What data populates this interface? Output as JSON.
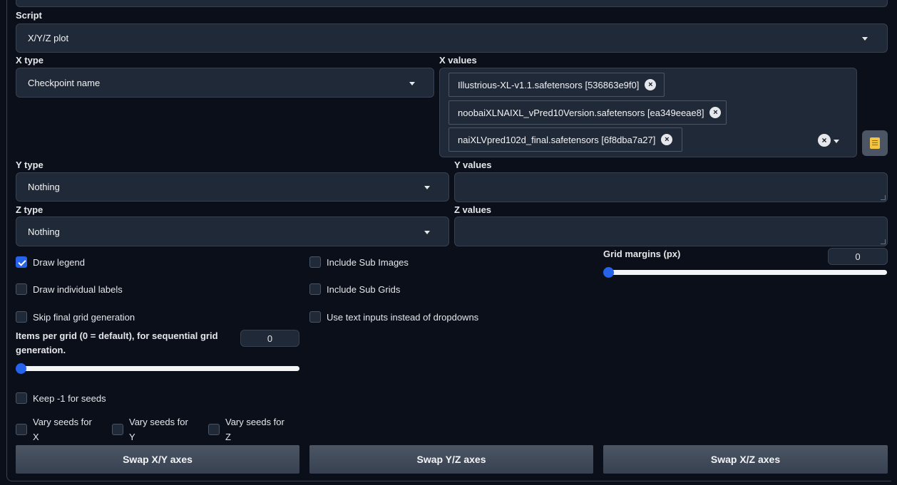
{
  "script": {
    "label": "Script",
    "value": "X/Y/Z plot"
  },
  "x_type": {
    "label": "X type",
    "value": "Checkpoint name"
  },
  "x_values": {
    "label": "X values",
    "tokens": [
      "Illustrious-XL-v1.1.safetensors [536863e9f0]",
      "noobaiXLNAIXL_vPred10Version.safetensors [ea349eeae8]",
      "naiXLVpred102d_final.safetensors [6f8dba7a27]"
    ],
    "remove_glyph": "×",
    "clear_glyph": "×"
  },
  "y_type": {
    "label": "Y type",
    "value": "Nothing"
  },
  "y_values": {
    "label": "Y values",
    "value": ""
  },
  "z_type": {
    "label": "Z type",
    "value": "Nothing"
  },
  "z_values": {
    "label": "Z values",
    "value": ""
  },
  "checkboxes": {
    "draw_legend": {
      "label": "Draw legend",
      "checked": true
    },
    "draw_individual_labels": {
      "label": "Draw individual labels",
      "checked": false
    },
    "skip_final_grid": {
      "label": "Skip final grid generation",
      "checked": false
    },
    "include_sub_images": {
      "label": "Include Sub Images",
      "checked": false
    },
    "include_sub_grids": {
      "label": "Include Sub Grids",
      "checked": false
    },
    "use_text_inputs": {
      "label": "Use text inputs instead of dropdowns",
      "checked": false
    },
    "keep_minus_one": {
      "label": "Keep -1 for seeds",
      "checked": false
    }
  },
  "vary_seeds": [
    {
      "line1": "Vary seeds for",
      "line2": "X"
    },
    {
      "line1": "Vary seeds for",
      "line2": "Y"
    },
    {
      "line1": "Vary seeds for",
      "line2": "Z"
    }
  ],
  "items_per_grid": {
    "label_line1": "Items per grid (0 = default), for sequential grid",
    "label_line2": "generation.",
    "value": "0",
    "slider_fraction": 0
  },
  "grid_margins": {
    "label": "Grid margins (px)",
    "value": "0",
    "slider_fraction": 0
  },
  "buttons": {
    "swap_xy": "Swap X/Y axes",
    "swap_yz": "Swap Y/Z axes",
    "swap_xz": "Swap X/Z axes"
  },
  "icons": {
    "book_button": "notebook-icon",
    "accent": "#2563eb"
  }
}
